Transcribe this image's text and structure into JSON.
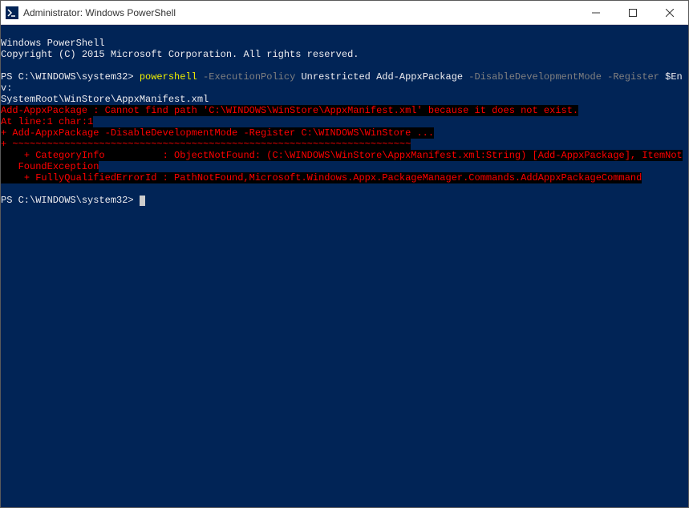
{
  "window": {
    "title": "Administrator: Windows PowerShell"
  },
  "banner": {
    "line1": "Windows PowerShell",
    "line2": "Copyright (C) 2015 Microsoft Corporation. All rights reserved."
  },
  "prompt1": {
    "prefix": "PS C:\\WINDOWS\\system32> ",
    "cmd": "powershell",
    "flag1": " -ExecutionPolicy",
    "arg1": " Unrestricted Add-AppxPackage",
    "flag2": " -DisableDevelopmentMode -Register",
    "arg2": " $Env:",
    "cont": "SystemRoot\\WinStore\\AppxManifest.xml"
  },
  "error": {
    "e1": "Add-AppxPackage : Cannot find path 'C:\\WINDOWS\\WinStore\\AppxManifest.xml' because it does not exist.",
    "e2": "At line:1 char:1",
    "e3": "+ Add-AppxPackage -DisableDevelopmentMode -Register C:\\WINDOWS\\WinStore ...",
    "e4": "+ ~~~~~~~~~~~~~~~~~~~~~~~~~~~~~~~~~~~~~~~~~~~~~~~~~~~~~~~~~~~~~~~~~~~~~",
    "e5a": "    + CategoryInfo          : ObjectNotFound: (C:\\WINDOWS\\WinStore\\AppxManifest.xml:String) [Add-AppxPackage], ItemNot",
    "e5b": "   FoundException",
    "e6": "    + FullyQualifiedErrorId : PathNotFound,Microsoft.Windows.Appx.PackageManager.Commands.AddAppxPackageCommand"
  },
  "prompt2": {
    "prefix": "PS C:\\WINDOWS\\system32> "
  }
}
